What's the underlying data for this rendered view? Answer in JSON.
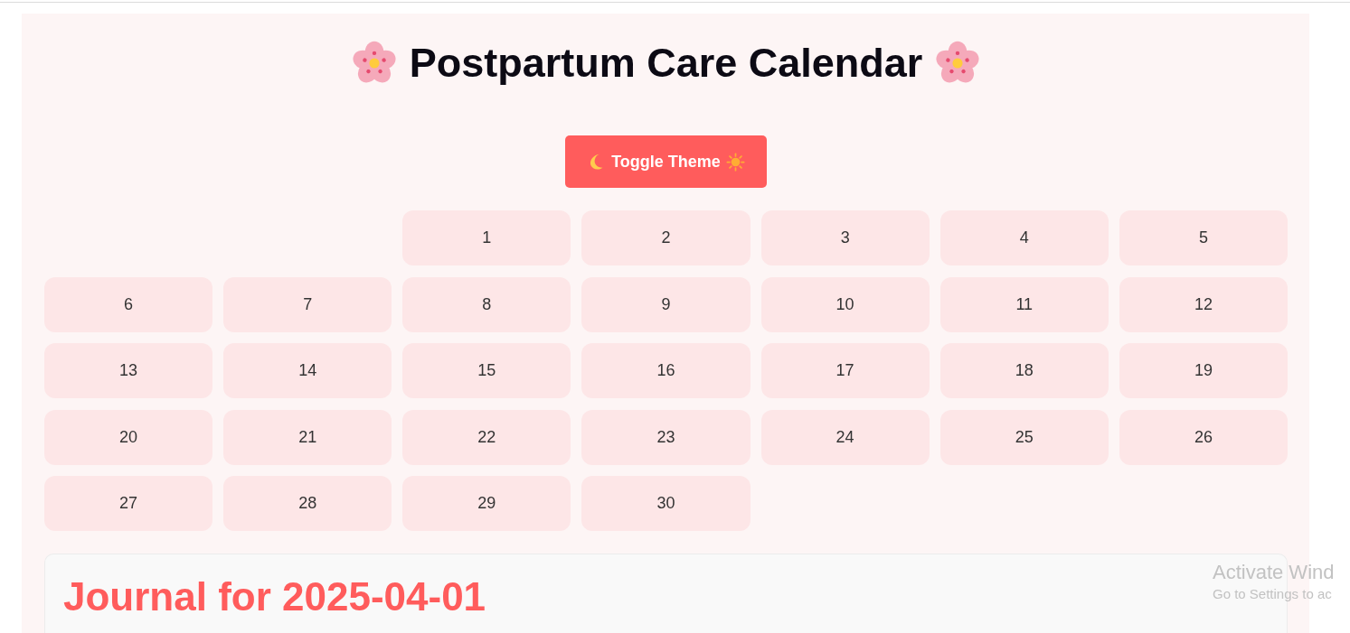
{
  "title": "Postpartum Care Calendar",
  "theme_button": {
    "label": "Toggle Theme"
  },
  "calendar": {
    "weeks": [
      [
        "1",
        "2",
        "3",
        "4",
        "5"
      ],
      [
        "6",
        "7",
        "8",
        "9",
        "10",
        "11",
        "12"
      ],
      [
        "13",
        "14",
        "15",
        "16",
        "17",
        "18",
        "19"
      ],
      [
        "20",
        "21",
        "22",
        "23",
        "24",
        "25",
        "26"
      ],
      [
        "27",
        "28",
        "29",
        "30"
      ]
    ]
  },
  "journal": {
    "heading": "Journal for 2025-04-01"
  },
  "activation_notice": {
    "title": "Activate Wind",
    "subtitle": "Go to Settings to ac"
  }
}
